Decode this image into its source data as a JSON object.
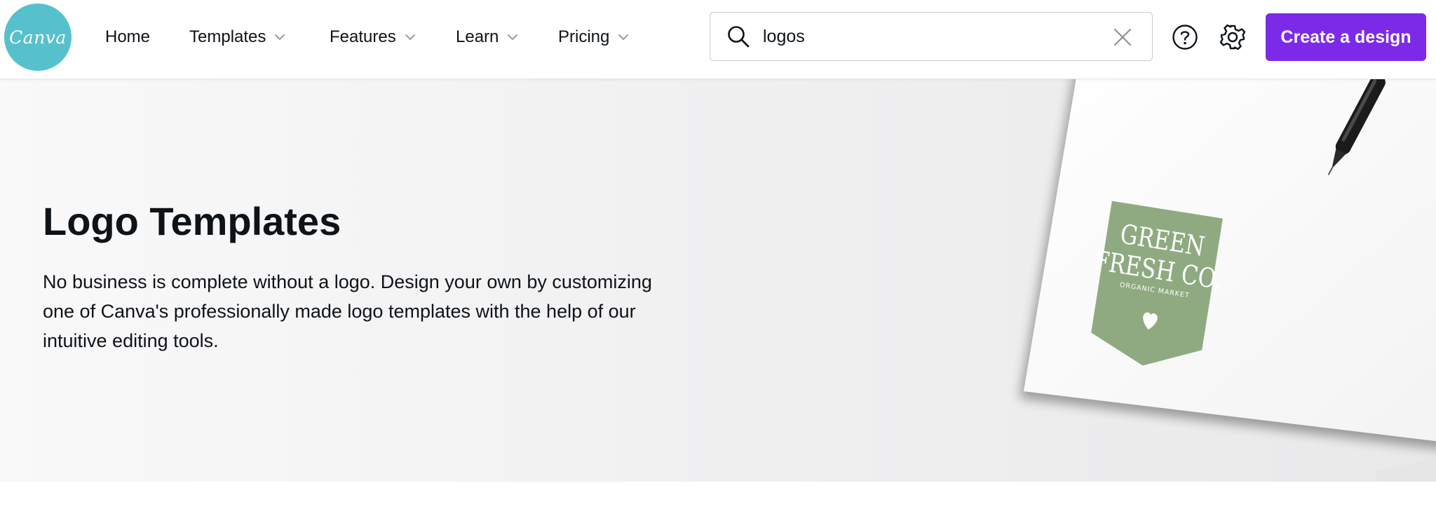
{
  "brand": {
    "logo_text": "Canva",
    "logo_color": "#56c1cc",
    "accent_color": "#7d2ae8"
  },
  "nav": {
    "items": [
      {
        "label": "Home"
      },
      {
        "label": "Templates"
      },
      {
        "label": "Features"
      },
      {
        "label": "Learn"
      },
      {
        "label": "Pricing"
      }
    ]
  },
  "search": {
    "value": "logos",
    "icon": "search-icon",
    "clear_icon": "close-icon"
  },
  "toolbar": {
    "help_icon": "help-icon",
    "settings_icon": "gear-icon",
    "cta_label": "Create a design"
  },
  "hero": {
    "title": "Logo Templates",
    "description": "No business is complete without a logo. Design your own by customizing one of Canva's professionally made logo templates with the help of our intuitive editing tools.",
    "artwork": {
      "badge_line1": "GREEN",
      "badge_line2": "FRESH CO.",
      "badge_subtitle": "ORGANIC MARKET",
      "badge_color": "#8faa80"
    }
  }
}
